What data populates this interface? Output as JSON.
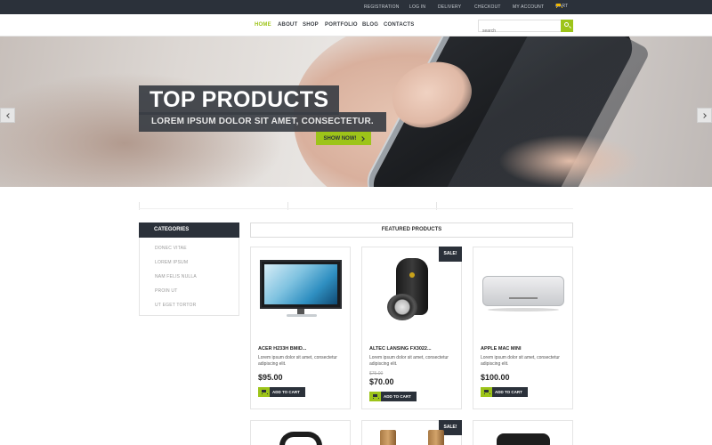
{
  "topbar": {
    "links": [
      "REGISTRATION",
      "LOG IN",
      "DELIVERY",
      "CHECKOUT",
      "MY ACCOUNT"
    ],
    "cart_label": "CART",
    "cart_icon": "cart-icon"
  },
  "nav": {
    "items": [
      "HOME",
      "ABOUT",
      "SHOP",
      "PORTFOLIO",
      "BLOG",
      "CONTACTS"
    ],
    "active": "HOME",
    "search_placeholder": "search"
  },
  "hero": {
    "title": "TOP PRODUCTS",
    "subtitle": "LOREM IPSUM DOLOR SIT AMET, CONSECTETUR.",
    "button": "SHOW NOW!"
  },
  "sidebar": {
    "heading": "CATEGORIES",
    "items": [
      "DONEC VITAE",
      "LOREM IPSUM",
      "NAM FELIS NULLA",
      "PROIN UT",
      "UT EGET TORTOR"
    ]
  },
  "featured": {
    "heading": "FEATURED PRODUCTS",
    "products": [
      {
        "name": "ACER H233H BMID...",
        "desc": "Lorem ipsum dolor sit amet, consectetur adipiscing elit.",
        "price": "$95.00",
        "old_price": "",
        "sale": "",
        "button": "ADD TO CART"
      },
      {
        "name": "ALTEC LANSING FX3022...",
        "desc": "Lorem ipsum dolor sit amet, consectetur adipiscing elit.",
        "price": "$70.00",
        "old_price": "$75.00",
        "sale": "SALE!",
        "button": "ADD TO CART"
      },
      {
        "name": "APPLE MAC MINI",
        "desc": "Lorem ipsum dolor sit amet, consectetur adipiscing elit.",
        "price": "$100.00",
        "old_price": "",
        "sale": "",
        "button": "ADD TO CART"
      }
    ],
    "second_row_sale": "SALE!"
  },
  "colors": {
    "accent": "#9dc419",
    "dark": "#2b313a"
  }
}
